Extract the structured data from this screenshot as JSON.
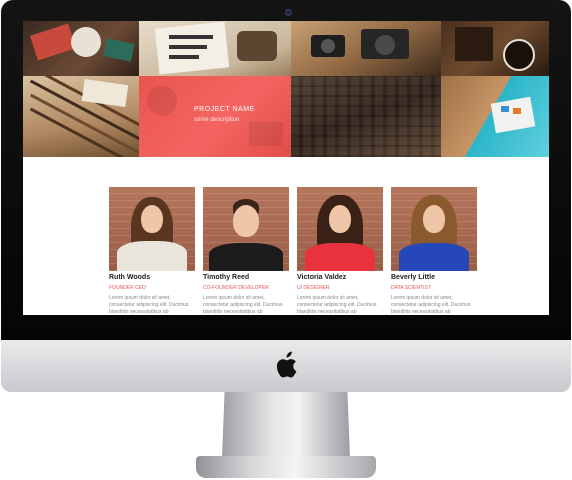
{
  "device": {
    "brand_logo_icon": "apple-logo-icon",
    "camera_icon": "camera-dot-icon"
  },
  "portfolio": {
    "tiles": [
      {
        "name": "tile-notebook-photo",
        "icon": "photo-icon"
      },
      {
        "name": "tile-handlettering-photo",
        "icon": "photo-icon"
      },
      {
        "name": "tile-cameras-photo",
        "icon": "photo-icon"
      },
      {
        "name": "tile-coffee-photo",
        "icon": "photo-icon"
      },
      {
        "name": "tile-pencils-photo",
        "icon": "photo-icon"
      },
      {
        "name": "tile-highlighted",
        "icon": "photo-icon"
      },
      {
        "name": "tile-typeset-photo",
        "icon": "photo-icon"
      },
      {
        "name": "tile-paint-photo",
        "icon": "photo-icon"
      }
    ],
    "highlight": {
      "project_name": "PROJECT NAME",
      "description": "some description"
    }
  },
  "team": [
    {
      "name": "Ruth Woods",
      "role": "FOUNDER CEO",
      "bio": "Lorem ipsum dolor sit amet, consectetur adipiscing elit. Ducimus blanditiis necessitatibus ab consectetur adipisci"
    },
    {
      "name": "Timothy Reed",
      "role": "CO-FOUNDER DEVELOPER",
      "bio": "Lorem ipsum dolor sit amet, consectetur adipiscing elit. Ducimus blanditiis necessitatibus ab consectetur adipisci"
    },
    {
      "name": "Victoria Valdez",
      "role": "UI DESIGNER",
      "bio": "Lorem ipsum dolor sit amet, consectetur adipiscing elit. Ducimus blanditiis necessitatibus ab consectetur adipisci"
    },
    {
      "name": "Beverly Little",
      "role": "DATA SCIENTIST",
      "bio": "Lorem ipsum dolor sit amet, consectetur adipiscing elit. Ducimus blanditiis necessitatibus ab consectetur adipisci"
    }
  ],
  "colors": {
    "accent": "#e8554f",
    "bezel": "#0a0a0a",
    "chin": "#dcdddf"
  }
}
